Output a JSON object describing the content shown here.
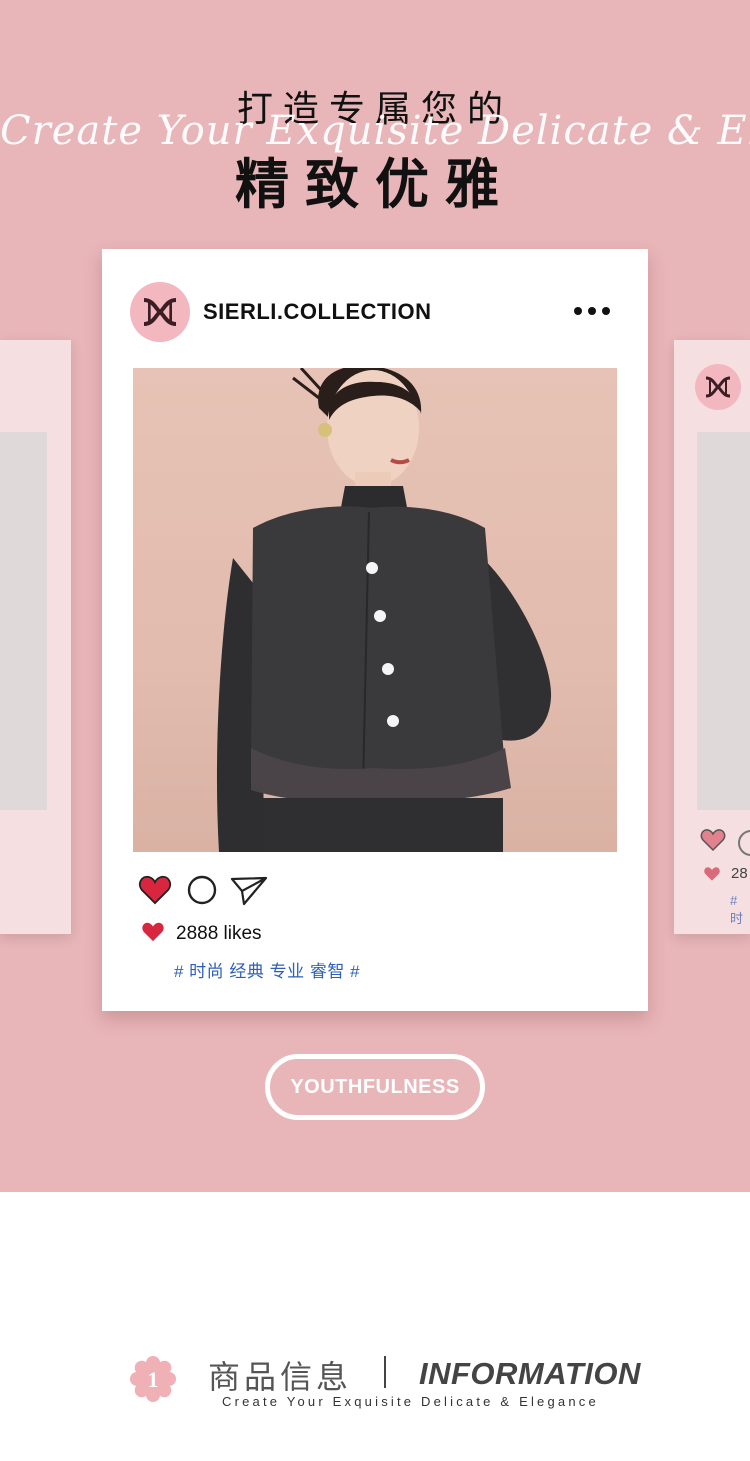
{
  "hero": {
    "title_line1": "打造专属您的",
    "script_line": "Create Your Exquisite Delicate & Elegance",
    "title_line2": "精致优雅"
  },
  "post": {
    "username": "SIERLI.COLLECTION",
    "likes": "2888 likes",
    "tags": "# 时尚 经典 专业 睿智 #"
  },
  "side_right": {
    "likes_partial": "28",
    "tags_partial": "# 时"
  },
  "badge": {
    "label": "YOUTHFULNESS"
  },
  "info": {
    "number": "1",
    "title_cn": "商品信息",
    "title_en": "INFORMATION",
    "subtitle": "Create Your Exquisite Delicate & Elegance"
  },
  "colors": {
    "hero_bg": "#e8b5b8",
    "heart_red": "#d8263e",
    "tag_blue": "#2d5fb8",
    "avatar_pink": "#f3b7c0"
  },
  "icons": [
    "logo-icon",
    "more-icon",
    "heart-icon",
    "comment-icon",
    "share-icon",
    "flower-icon"
  ]
}
